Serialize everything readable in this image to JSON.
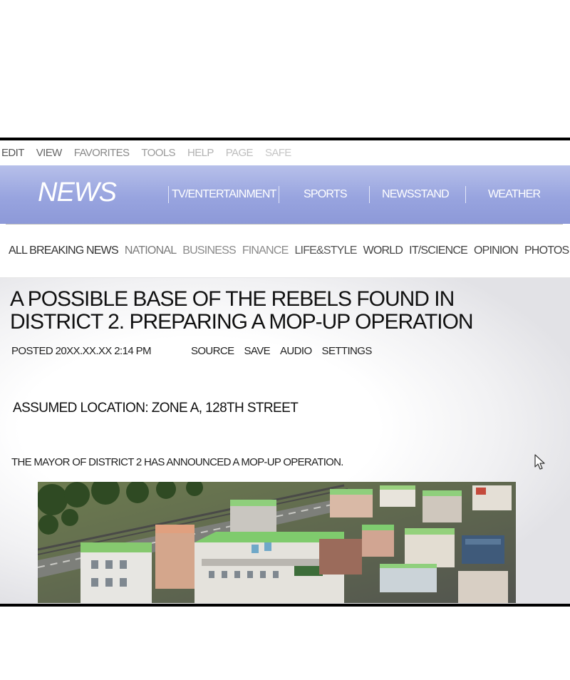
{
  "menu_bar": [
    "EDIT",
    "VIEW",
    "FAVORITES",
    "TOOLS",
    "HELP",
    "PAGE",
    "SAFE"
  ],
  "header": {
    "logo": "NEWS",
    "nav": [
      "TV/ENTERTAINMENT",
      "SPORTS",
      "NEWSSTAND",
      "WEATHER"
    ],
    "gradient": [
      "#b7c0ea",
      "#8d99d8"
    ]
  },
  "categories": [
    "ALL BREAKING NEWS",
    "NATIONAL",
    "BUSINESS",
    "FINANCE",
    "LIFE&STYLE",
    "WORLD",
    "IT/SCIENCE",
    "OPINION",
    "PHOTOS"
  ],
  "article": {
    "headline_line1": "A POSSIBLE BASE OF THE REBELS FOUND IN",
    "headline_line2": "DISTRICT 2. PREPARING A MOP-UP OPERATION",
    "posted": "POSTED 20XX.XX.XX 2:14 PM",
    "actions": [
      "SOURCE",
      "SAVE",
      "AUDIO",
      "SETTINGS"
    ],
    "subheading": "ASSUMED LOCATION: ZONE A, 128TH STREET",
    "body": "THE MAYOR OF DISTRICT 2 HAS ANNOUNCED A MOP-UP OPERATION.",
    "image_icon": "city-aerial-photo"
  },
  "cursor_icon": "mouse-pointer-icon"
}
